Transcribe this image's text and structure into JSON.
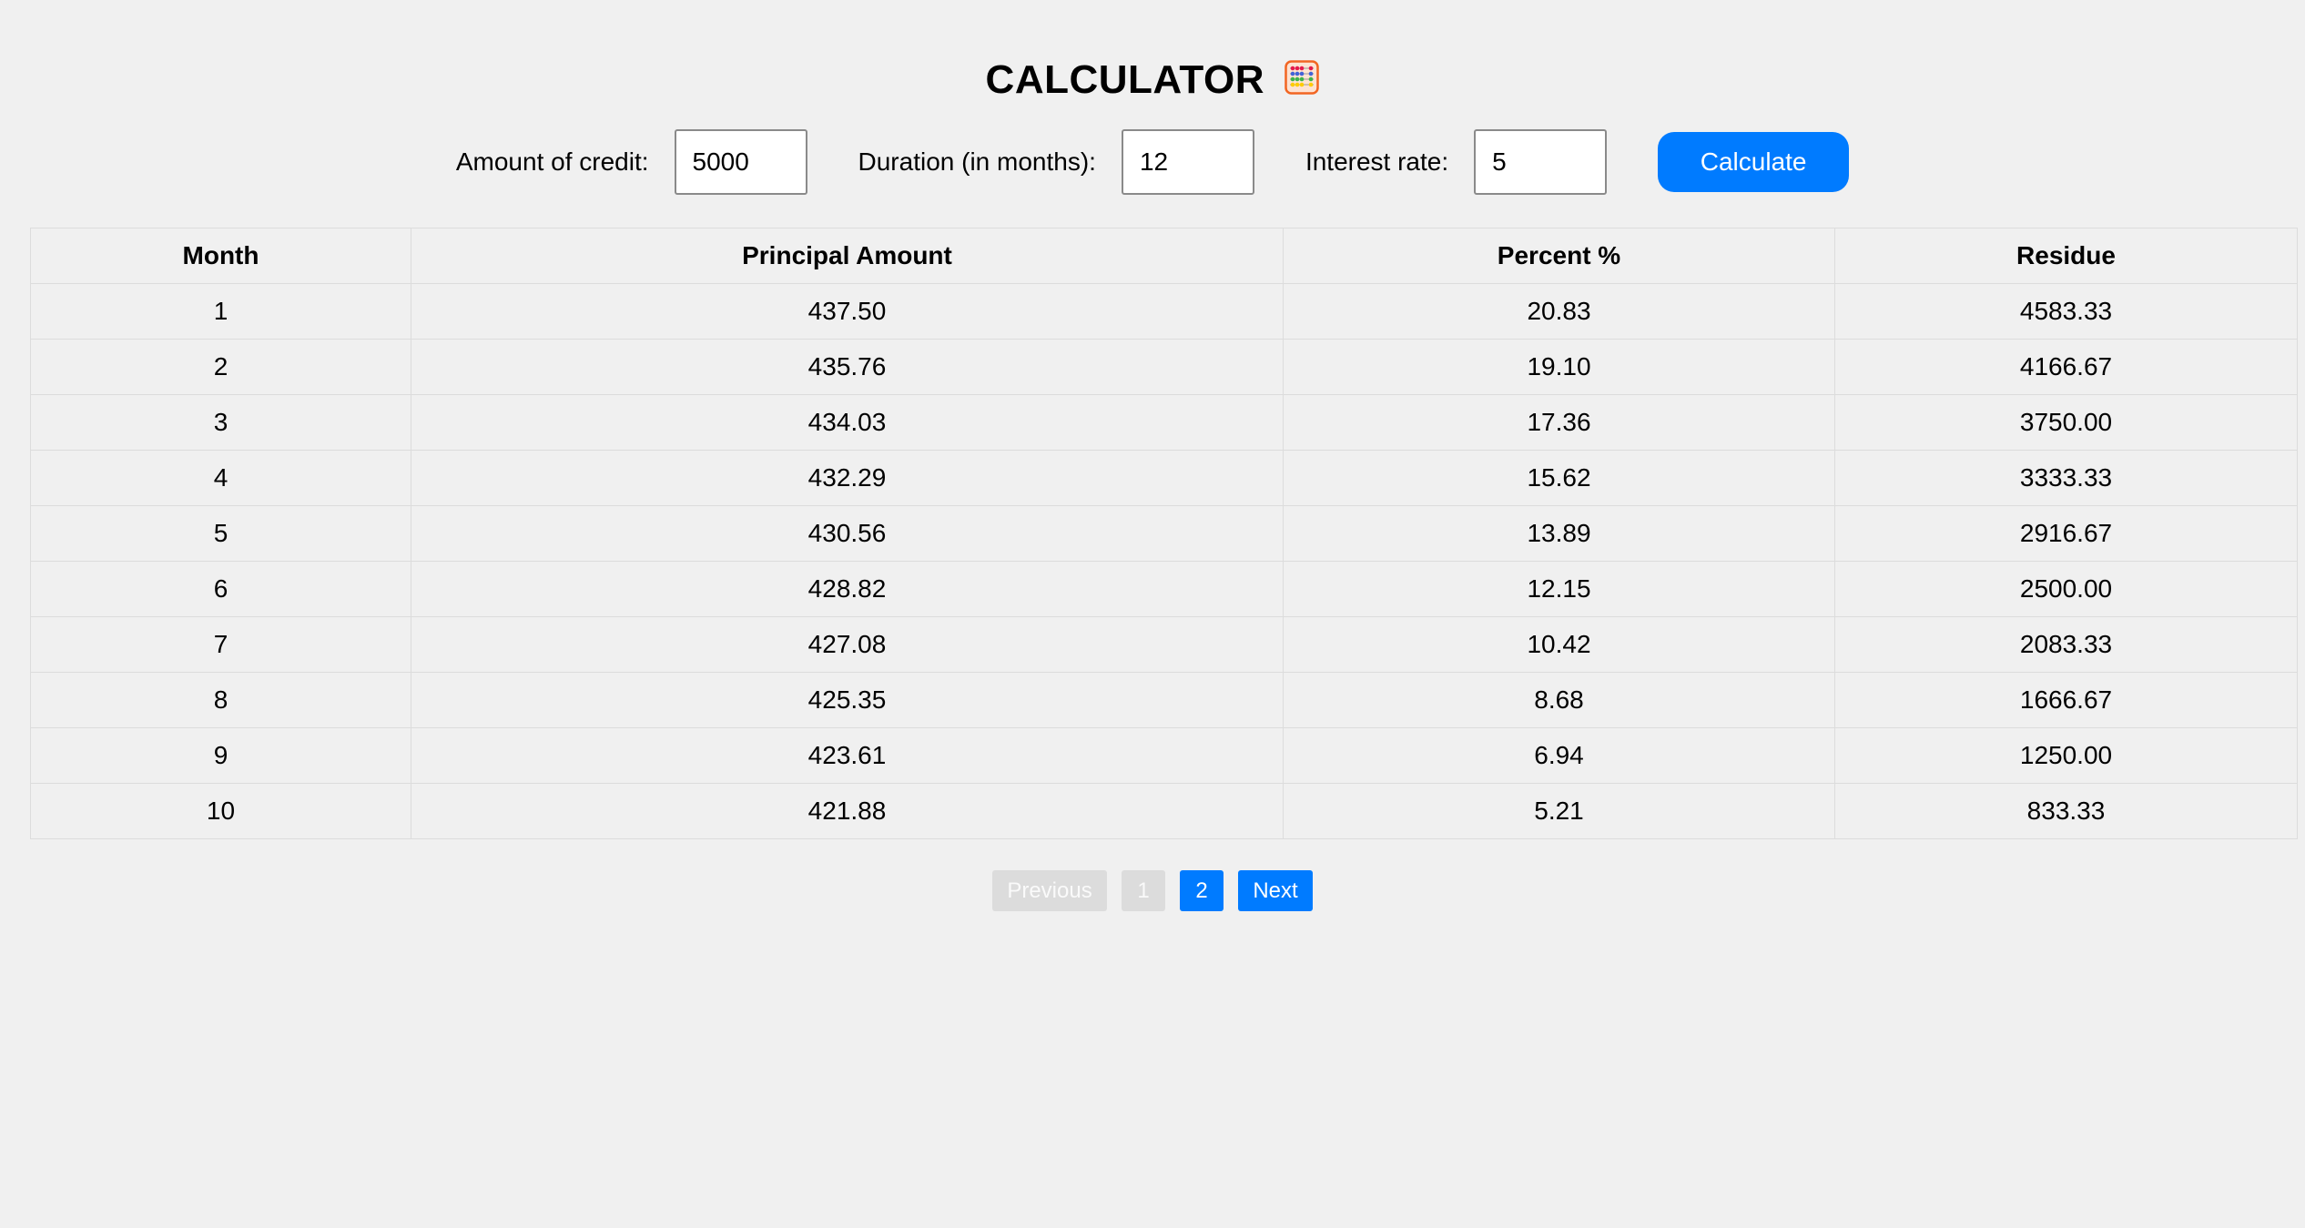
{
  "header": {
    "title": "CALCULATOR",
    "icon": "abacus-icon"
  },
  "form": {
    "amount_label": "Amount of credit:",
    "amount_value": "5000",
    "duration_label": "Duration (in months):",
    "duration_value": "12",
    "rate_label": "Interest rate:",
    "rate_value": "5",
    "calculate_label": "Calculate"
  },
  "table": {
    "columns": [
      "Month",
      "Principal Amount",
      "Percent %",
      "Residue"
    ],
    "rows": [
      [
        "1",
        "437.50",
        "20.83",
        "4583.33"
      ],
      [
        "2",
        "435.76",
        "19.10",
        "4166.67"
      ],
      [
        "3",
        "434.03",
        "17.36",
        "3750.00"
      ],
      [
        "4",
        "432.29",
        "15.62",
        "3333.33"
      ],
      [
        "5",
        "430.56",
        "13.89",
        "2916.67"
      ],
      [
        "6",
        "428.82",
        "12.15",
        "2500.00"
      ],
      [
        "7",
        "427.08",
        "10.42",
        "2083.33"
      ],
      [
        "8",
        "425.35",
        "8.68",
        "1666.67"
      ],
      [
        "9",
        "423.61",
        "6.94",
        "1250.00"
      ],
      [
        "10",
        "421.88",
        "5.21",
        "833.33"
      ]
    ]
  },
  "pagination": {
    "previous_label": "Previous",
    "page_1_label": "1",
    "page_2_label": "2",
    "next_label": "Next",
    "current_page": 2
  },
  "colors": {
    "accent": "#007bff",
    "background": "#f0f0f0",
    "disabled": "#dcdcdc"
  }
}
